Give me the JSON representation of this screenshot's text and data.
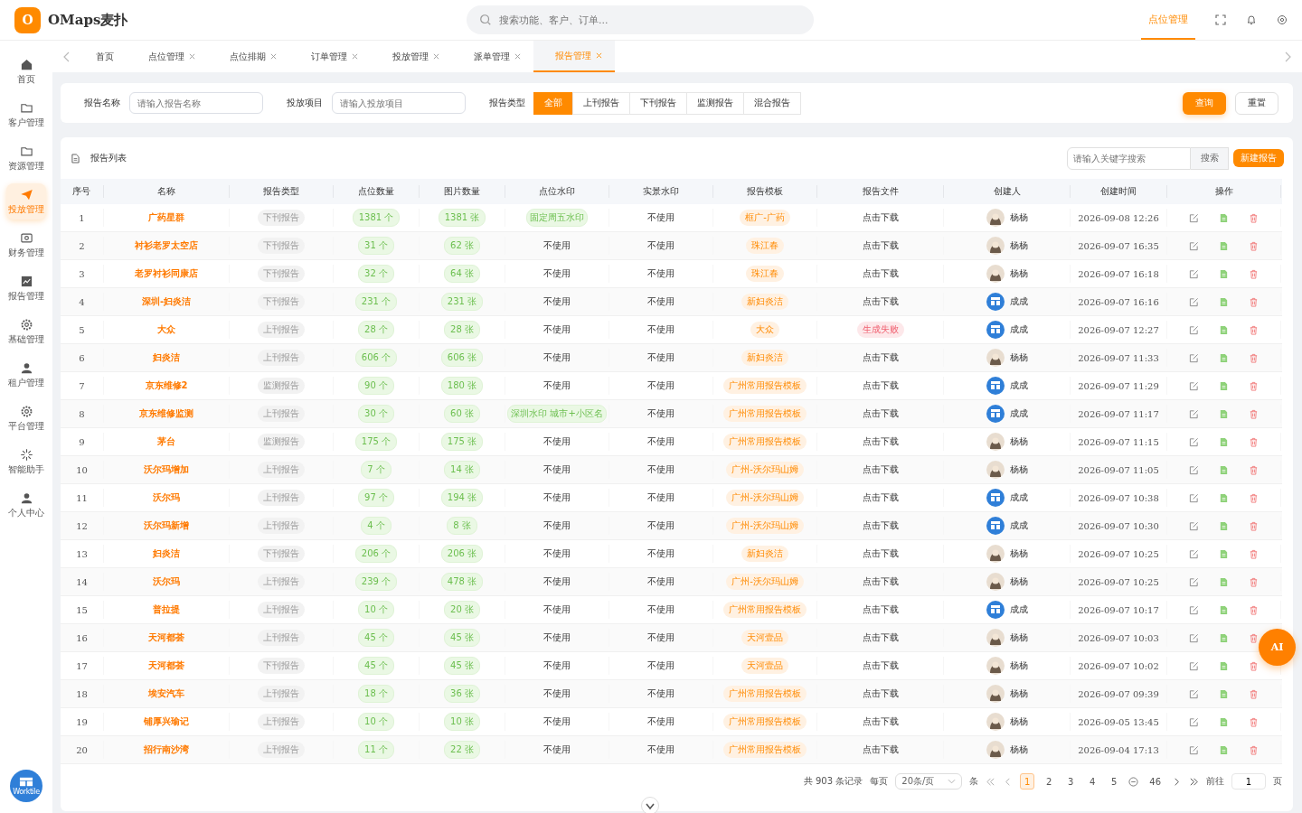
{
  "app": {
    "logo_letter": "O",
    "name": "OMaps麦扑"
  },
  "search": {
    "placeholder": "搜索功能、客户、订单..."
  },
  "top_nav": [
    {
      "label": "点位管理",
      "selected": true
    }
  ],
  "sidebar": {
    "items": [
      {
        "label": "首页",
        "selected": false
      },
      {
        "label": "客户管理",
        "selected": false
      },
      {
        "label": "资源管理",
        "selected": false
      },
      {
        "label": "投放管理",
        "selected": true
      },
      {
        "label": "财务管理",
        "selected": false
      },
      {
        "label": "报告管理",
        "selected": false
      },
      {
        "label": "基础管理",
        "selected": false
      },
      {
        "label": "租户管理",
        "selected": false
      },
      {
        "label": "平台管理",
        "selected": false
      },
      {
        "label": "智能助手",
        "selected": false
      },
      {
        "label": "个人中心",
        "selected": false
      }
    ],
    "badge_label": "Worktile"
  },
  "tabs": [
    {
      "label": "首页",
      "closable": false,
      "selected": false
    },
    {
      "label": "点位管理",
      "closable": true,
      "selected": false
    },
    {
      "label": "点位排期",
      "closable": true,
      "selected": false
    },
    {
      "label": "订单管理",
      "closable": true,
      "selected": false
    },
    {
      "label": "投放管理",
      "closable": true,
      "selected": false
    },
    {
      "label": "派单管理",
      "closable": true,
      "selected": false
    },
    {
      "label": "报告管理",
      "closable": true,
      "selected": true
    }
  ],
  "filters": {
    "name_label": "报告名称",
    "name_placeholder": "请输入报告名称",
    "project_label": "投放项目",
    "project_placeholder": "请输入投放项目",
    "type_label": "报告类型",
    "types": [
      {
        "label": "全部",
        "selected": true
      },
      {
        "label": "上刊报告",
        "selected": false
      },
      {
        "label": "下刊报告",
        "selected": false
      },
      {
        "label": "监测报告",
        "selected": false
      },
      {
        "label": "混合报告",
        "selected": false
      }
    ],
    "query_button": "查询",
    "reset_button": "重置"
  },
  "list": {
    "title": "报告列表",
    "search_placeholder": "请输入关键字搜索",
    "search_button": "搜索",
    "new_button": "新建报告"
  },
  "table": {
    "columns": [
      "序号",
      "名称",
      "报告类型",
      "点位数量",
      "图片数量",
      "点位水印",
      "实景水印",
      "报告模板",
      "报告文件",
      "创建人",
      "创建时间",
      "操作"
    ],
    "rows": [
      {
        "index": "1",
        "name": "广药星群",
        "type": "下刊报告",
        "points": "1381 个",
        "images": "1381 张",
        "watermark": {
          "text": "固定周五水印",
          "kind": "tag"
        },
        "live_watermark": "不使用",
        "template": "框广-广药",
        "file": {
          "text": "点击下载",
          "kind": "link"
        },
        "creator": {
          "name": "杨杨",
          "kind": "photo"
        },
        "time": "2026-09-08 12:26"
      },
      {
        "index": "2",
        "name": "衬衫老罗太空店",
        "type": "下刊报告",
        "points": "31 个",
        "images": "62 张",
        "watermark": {
          "text": "不使用",
          "kind": "plain"
        },
        "live_watermark": "不使用",
        "template": "珠江春",
        "file": {
          "text": "点击下载",
          "kind": "link"
        },
        "creator": {
          "name": "杨杨",
          "kind": "photo"
        },
        "time": "2026-09-07 16:35"
      },
      {
        "index": "3",
        "name": "老罗衬衫同康店",
        "type": "下刊报告",
        "points": "32 个",
        "images": "64 张",
        "watermark": {
          "text": "不使用",
          "kind": "plain"
        },
        "live_watermark": "不使用",
        "template": "珠江春",
        "file": {
          "text": "点击下载",
          "kind": "link"
        },
        "creator": {
          "name": "杨杨",
          "kind": "photo"
        },
        "time": "2026-09-07 16:18"
      },
      {
        "index": "4",
        "name": "深圳-妇炎洁",
        "type": "下刊报告",
        "points": "231 个",
        "images": "231 张",
        "watermark": {
          "text": "不使用",
          "kind": "plain"
        },
        "live_watermark": "不使用",
        "template": "新妇炎洁",
        "file": {
          "text": "点击下载",
          "kind": "link"
        },
        "creator": {
          "name": "成成",
          "kind": "logo"
        },
        "time": "2026-09-07 16:16"
      },
      {
        "index": "5",
        "name": "大众",
        "type": "上刊报告",
        "points": "28 个",
        "images": "28 张",
        "watermark": {
          "text": "不使用",
          "kind": "plain"
        },
        "live_watermark": "不使用",
        "template": "大众",
        "file": {
          "text": "生成失败",
          "kind": "error"
        },
        "creator": {
          "name": "成成",
          "kind": "logo"
        },
        "time": "2026-09-07 12:27"
      },
      {
        "index": "6",
        "name": "妇炎洁",
        "type": "上刊报告",
        "points": "606 个",
        "images": "606 张",
        "watermark": {
          "text": "不使用",
          "kind": "plain"
        },
        "live_watermark": "不使用",
        "template": "新妇炎洁",
        "file": {
          "text": "点击下载",
          "kind": "link"
        },
        "creator": {
          "name": "杨杨",
          "kind": "photo"
        },
        "time": "2026-09-07 11:33"
      },
      {
        "index": "7",
        "name": "京东维修2",
        "type": "监测报告",
        "points": "90 个",
        "images": "180 张",
        "watermark": {
          "text": "不使用",
          "kind": "plain"
        },
        "live_watermark": "不使用",
        "template": "广州常用报告模板",
        "file": {
          "text": "点击下载",
          "kind": "link"
        },
        "creator": {
          "name": "成成",
          "kind": "logo"
        },
        "time": "2026-09-07 11:29"
      },
      {
        "index": "8",
        "name": "京东维修监测",
        "type": "上刊报告",
        "points": "30 个",
        "images": "60 张",
        "watermark": {
          "text": "深圳水印 城市+小区名",
          "kind": "tag"
        },
        "live_watermark": "不使用",
        "template": "广州常用报告模板",
        "file": {
          "text": "点击下载",
          "kind": "link"
        },
        "creator": {
          "name": "成成",
          "kind": "logo"
        },
        "time": "2026-09-07 11:17"
      },
      {
        "index": "9",
        "name": "茅台",
        "type": "监测报告",
        "points": "175 个",
        "images": "175 张",
        "watermark": {
          "text": "不使用",
          "kind": "plain"
        },
        "live_watermark": "不使用",
        "template": "广州常用报告模板",
        "file": {
          "text": "点击下载",
          "kind": "link"
        },
        "creator": {
          "name": "杨杨",
          "kind": "photo"
        },
        "time": "2026-09-07 11:15"
      },
      {
        "index": "10",
        "name": "沃尔玛增加",
        "type": "上刊报告",
        "points": "7 个",
        "images": "14 张",
        "watermark": {
          "text": "不使用",
          "kind": "plain"
        },
        "live_watermark": "不使用",
        "template": "广州-沃尔玛山姆",
        "file": {
          "text": "点击下载",
          "kind": "link"
        },
        "creator": {
          "name": "杨杨",
          "kind": "photo"
        },
        "time": "2026-09-07 11:05"
      },
      {
        "index": "11",
        "name": "沃尔玛",
        "type": "上刊报告",
        "points": "97 个",
        "images": "194 张",
        "watermark": {
          "text": "不使用",
          "kind": "plain"
        },
        "live_watermark": "不使用",
        "template": "广州-沃尔玛山姆",
        "file": {
          "text": "点击下载",
          "kind": "link"
        },
        "creator": {
          "name": "成成",
          "kind": "logo"
        },
        "time": "2026-09-07 10:38"
      },
      {
        "index": "12",
        "name": "沃尔玛新增",
        "type": "上刊报告",
        "points": "4 个",
        "images": "8 张",
        "watermark": {
          "text": "不使用",
          "kind": "plain"
        },
        "live_watermark": "不使用",
        "template": "广州-沃尔玛山姆",
        "file": {
          "text": "点击下载",
          "kind": "link"
        },
        "creator": {
          "name": "成成",
          "kind": "logo"
        },
        "time": "2026-09-07 10:30"
      },
      {
        "index": "13",
        "name": "妇炎洁",
        "type": "下刊报告",
        "points": "206 个",
        "images": "206 张",
        "watermark": {
          "text": "不使用",
          "kind": "plain"
        },
        "live_watermark": "不使用",
        "template": "新妇炎洁",
        "file": {
          "text": "点击下载",
          "kind": "link"
        },
        "creator": {
          "name": "杨杨",
          "kind": "photo"
        },
        "time": "2026-09-07 10:25"
      },
      {
        "index": "14",
        "name": "沃尔玛",
        "type": "上刊报告",
        "points": "239 个",
        "images": "478 张",
        "watermark": {
          "text": "不使用",
          "kind": "plain"
        },
        "live_watermark": "不使用",
        "template": "广州-沃尔玛山姆",
        "file": {
          "text": "点击下载",
          "kind": "link"
        },
        "creator": {
          "name": "杨杨",
          "kind": "photo"
        },
        "time": "2026-09-07 10:25"
      },
      {
        "index": "15",
        "name": "普拉提",
        "type": "上刊报告",
        "points": "10 个",
        "images": "20 张",
        "watermark": {
          "text": "不使用",
          "kind": "plain"
        },
        "live_watermark": "不使用",
        "template": "广州常用报告模板",
        "file": {
          "text": "点击下载",
          "kind": "link"
        },
        "creator": {
          "name": "成成",
          "kind": "logo"
        },
        "time": "2026-09-07 10:17"
      },
      {
        "index": "16",
        "name": "天河都荟",
        "type": "上刊报告",
        "points": "45 个",
        "images": "45 张",
        "watermark": {
          "text": "不使用",
          "kind": "plain"
        },
        "live_watermark": "不使用",
        "template": "天河壹品",
        "file": {
          "text": "点击下载",
          "kind": "link"
        },
        "creator": {
          "name": "杨杨",
          "kind": "photo"
        },
        "time": "2026-09-07 10:03"
      },
      {
        "index": "17",
        "name": "天河都荟",
        "type": "下刊报告",
        "points": "45 个",
        "images": "45 张",
        "watermark": {
          "text": "不使用",
          "kind": "plain"
        },
        "live_watermark": "不使用",
        "template": "天河壹品",
        "file": {
          "text": "点击下载",
          "kind": "link"
        },
        "creator": {
          "name": "杨杨",
          "kind": "photo"
        },
        "time": "2026-09-07 10:02"
      },
      {
        "index": "18",
        "name": "埃安汽车",
        "type": "上刊报告",
        "points": "18 个",
        "images": "36 张",
        "watermark": {
          "text": "不使用",
          "kind": "plain"
        },
        "live_watermark": "不使用",
        "template": "广州常用报告模板",
        "file": {
          "text": "点击下载",
          "kind": "link"
        },
        "creator": {
          "name": "杨杨",
          "kind": "photo"
        },
        "time": "2026-09-07 09:39"
      },
      {
        "index": "19",
        "name": "铺厚兴瑜记",
        "type": "上刊报告",
        "points": "10 个",
        "images": "10 张",
        "watermark": {
          "text": "不使用",
          "kind": "plain"
        },
        "live_watermark": "不使用",
        "template": "广州常用报告模板",
        "file": {
          "text": "点击下载",
          "kind": "link"
        },
        "creator": {
          "name": "杨杨",
          "kind": "photo"
        },
        "time": "2026-09-05 13:45"
      },
      {
        "index": "20",
        "name": "招行南沙湾",
        "type": "上刊报告",
        "points": "11 个",
        "images": "22 张",
        "watermark": {
          "text": "不使用",
          "kind": "plain"
        },
        "live_watermark": "不使用",
        "template": "广州常用报告模板",
        "file": {
          "text": "点击下载",
          "kind": "link"
        },
        "creator": {
          "name": "杨杨",
          "kind": "photo"
        },
        "time": "2026-09-04 17:13"
      }
    ]
  },
  "pagination": {
    "total": "共 903 条记录",
    "per_page_label": "每页",
    "page_size": "20条/页",
    "unit": "条",
    "pages": [
      {
        "label": "1",
        "selected": true
      },
      {
        "label": "2",
        "selected": false
      },
      {
        "label": "3",
        "selected": false
      },
      {
        "label": "4",
        "selected": false
      },
      {
        "label": "5",
        "selected": false
      }
    ],
    "last_page": "46",
    "goto_label": "前往",
    "goto_value": "1",
    "page_unit": "页"
  },
  "ai_button": "AI"
}
